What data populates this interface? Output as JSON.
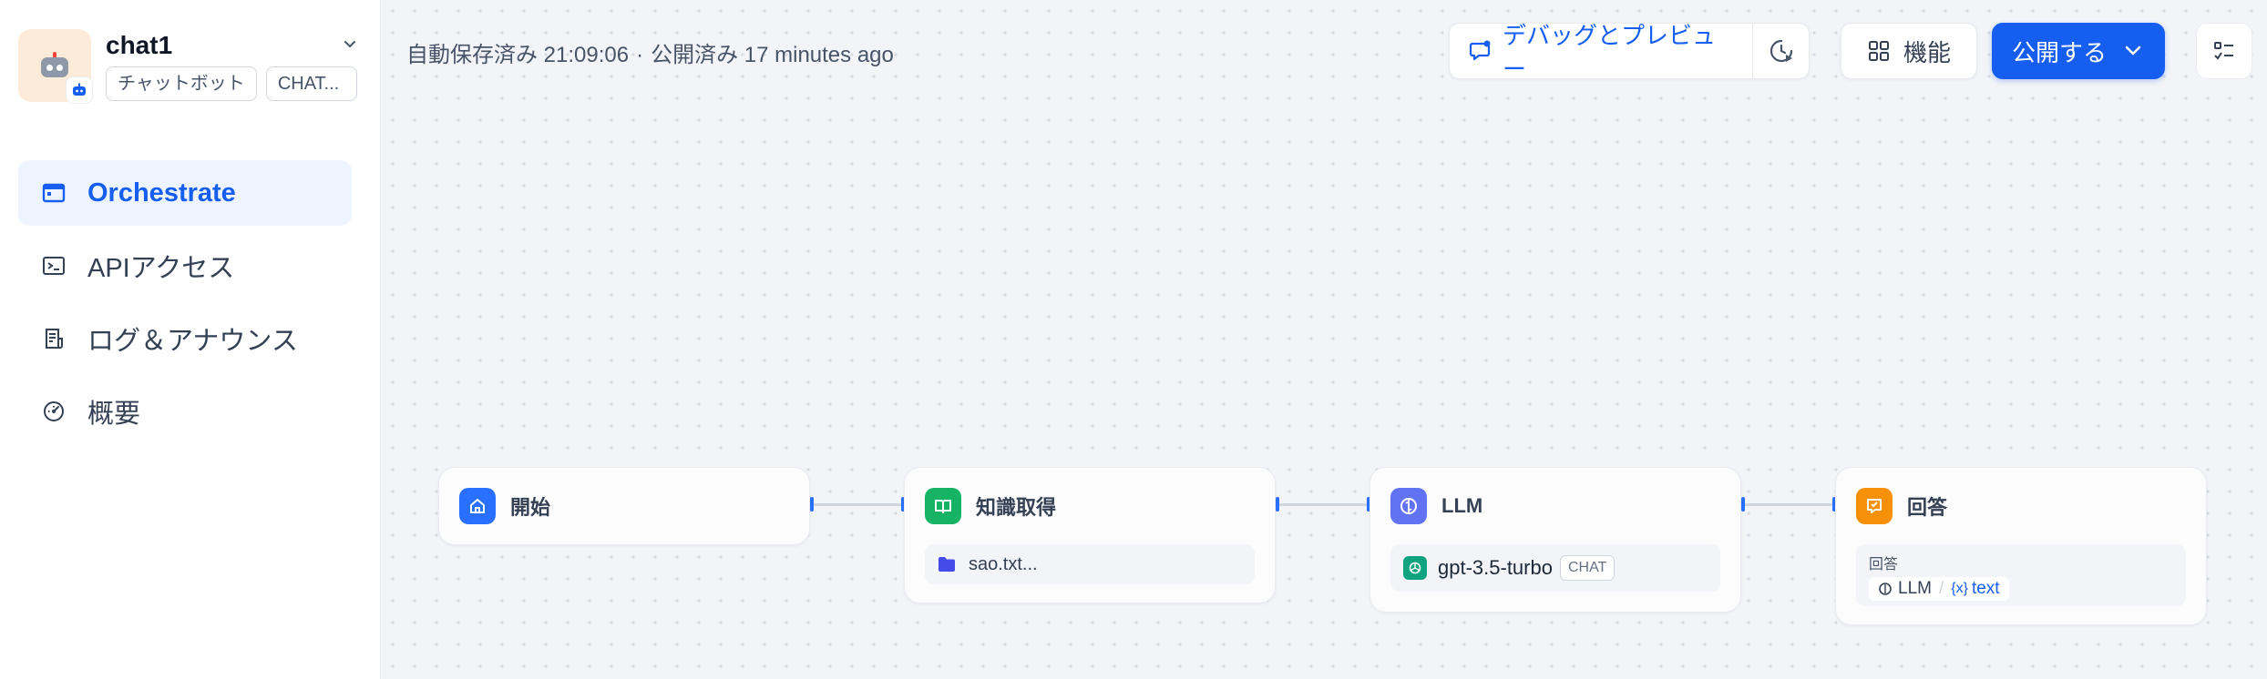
{
  "app": {
    "title": "chat1",
    "tags": [
      "チャットボット",
      "CHAT..."
    ]
  },
  "nav": [
    {
      "label": "Orchestrate",
      "icon": "orchestrate-icon",
      "active": true
    },
    {
      "label": "APIアクセス",
      "icon": "terminal-icon",
      "active": false
    },
    {
      "label": "ログ＆アナウンス",
      "icon": "log-icon",
      "active": false
    },
    {
      "label": "概要",
      "icon": "dashboard-icon",
      "active": false
    }
  ],
  "status": {
    "autosave": "自動保存済み 21:09:06",
    "sep": "·",
    "published": "公開済み 17 minutes ago"
  },
  "toolbar": {
    "debug_label": "デバッグとプレビュー",
    "features_label": "機能",
    "publish_label": "公開する"
  },
  "nodes": {
    "start": {
      "title": "開始"
    },
    "knowledge": {
      "title": "知識取得",
      "dataset": "sao.txt..."
    },
    "llm": {
      "title": "LLM",
      "model": "gpt-3.5-turbo",
      "mode": "CHAT"
    },
    "answer": {
      "title": "回答",
      "field_label": "回答",
      "var_node": "LLM",
      "var_sep": "/",
      "var_name": "text"
    }
  },
  "colors": {
    "accent": "#155eef",
    "start_icon": "#2970ff",
    "knowledge_icon": "#16b364",
    "llm_icon": "#6172f3",
    "answer_icon": "#f79009"
  }
}
